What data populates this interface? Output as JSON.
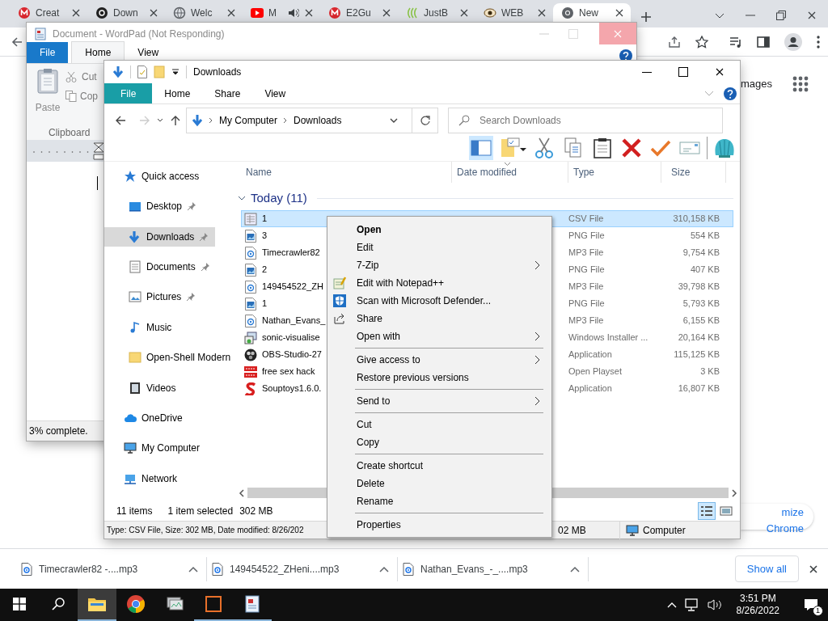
{
  "browser": {
    "tabs": [
      {
        "title": "Creat",
        "kind": "mega",
        "audio": false,
        "selected": false
      },
      {
        "title": "Down",
        "kind": "dark",
        "audio": false,
        "selected": false
      },
      {
        "title": "Welc",
        "kind": "globe",
        "audio": false,
        "selected": false
      },
      {
        "title": "M",
        "kind": "video",
        "audio": true,
        "selected": false
      },
      {
        "title": "E2Gu",
        "kind": "mega",
        "audio": false,
        "selected": false
      },
      {
        "title": "JustB",
        "kind": "wave",
        "audio": false,
        "selected": false
      },
      {
        "title": "WEB",
        "kind": "eye",
        "audio": false,
        "selected": false
      },
      {
        "title": "New",
        "kind": "chrome",
        "audio": false,
        "selected": true
      }
    ],
    "page_link": "mages",
    "customize_button": "mize Chrome"
  },
  "wordpad": {
    "title": "Document - WordPad (Not Responding)",
    "tabs": [
      {
        "label": "File",
        "kind": "file",
        "selected": false
      },
      {
        "label": "Home",
        "kind": "tab",
        "selected": true
      },
      {
        "label": "View",
        "kind": "tab",
        "selected": false
      }
    ],
    "paste": "Paste",
    "cut": "Cut",
    "copy": "Cop",
    "group": "Clipboard",
    "status": "3% complete."
  },
  "explorer": {
    "title": "Downloads",
    "tabs": [
      {
        "label": "File",
        "kind": "file",
        "selected": false
      },
      {
        "label": "Home",
        "kind": "tab",
        "selected": false
      },
      {
        "label": "Share",
        "kind": "tab",
        "selected": false
      },
      {
        "label": "View",
        "kind": "tab",
        "selected": false
      }
    ],
    "breadcrumb": [
      "My Computer",
      "Downloads"
    ],
    "search": {
      "placeholder": "Search Downloads"
    },
    "toolbar": [
      {
        "kind": "pane",
        "selected": true
      },
      {
        "kind": "folder",
        "selected": false
      },
      {
        "kind": "cut",
        "selected": false
      },
      {
        "kind": "copy",
        "selected": false
      },
      {
        "kind": "paste",
        "selected": false
      },
      {
        "kind": "delete",
        "selected": false
      },
      {
        "kind": "check",
        "selected": false
      },
      {
        "kind": "mail",
        "selected": false
      },
      {
        "kind": "shell",
        "selected": false
      }
    ],
    "nav": [
      {
        "label": "Quick access",
        "kind": "star",
        "children": [
          {
            "label": "Desktop",
            "kind": "desktop",
            "pinned": true,
            "selected": false
          },
          {
            "label": "Downloads",
            "kind": "download",
            "pinned": true,
            "selected": true
          },
          {
            "label": "Documents",
            "kind": "docs",
            "pinned": true,
            "selected": false
          },
          {
            "label": "Pictures",
            "kind": "pictures",
            "pinned": true,
            "selected": false
          },
          {
            "label": "Music",
            "kind": "music",
            "pinned": false,
            "selected": false
          },
          {
            "label": "Open-Shell Modern",
            "kind": "folder",
            "pinned": false,
            "selected": false
          },
          {
            "label": "Videos",
            "kind": "videos",
            "pinned": false,
            "selected": false
          }
        ]
      },
      {
        "label": "OneDrive",
        "kind": "cloud"
      },
      {
        "label": "My Computer",
        "kind": "computer"
      },
      {
        "label": "Network",
        "kind": "network"
      }
    ],
    "columns": [
      {
        "label": "Name",
        "sorted": false
      },
      {
        "label": "Date modified",
        "sorted": true
      },
      {
        "label": "Type",
        "sorted": false
      },
      {
        "label": "Size",
        "sorted": false
      }
    ],
    "group": {
      "label": "Today (11)",
      "expanded": true
    },
    "files": [
      {
        "name": "1",
        "kind": "csv",
        "type": "CSV File",
        "size": "310,158 KB",
        "selected": true
      },
      {
        "name": "3",
        "kind": "png",
        "type": "PNG File",
        "size": "554 KB",
        "selected": false
      },
      {
        "name": "Timecrawler82",
        "kind": "mp3",
        "type": "MP3 File",
        "size": "9,754 KB",
        "selected": false
      },
      {
        "name": "2",
        "kind": "png",
        "type": "PNG File",
        "size": "407 KB",
        "selected": false
      },
      {
        "name": "149454522_ZH",
        "kind": "mp3",
        "type": "MP3 File",
        "size": "39,798 KB",
        "selected": false
      },
      {
        "name": "1",
        "kind": "png",
        "type": "PNG File",
        "size": "5,793 KB",
        "selected": false
      },
      {
        "name": "Nathan_Evans_",
        "kind": "mp3",
        "type": "MP3 File",
        "size": "6,155 KB",
        "selected": false
      },
      {
        "name": "sonic-visualise",
        "kind": "msi",
        "type": "Windows Installer ...",
        "size": "20,164 KB",
        "selected": false
      },
      {
        "name": "OBS-Studio-27",
        "kind": "obs",
        "type": "Application",
        "size": "115,125 KB",
        "selected": false
      },
      {
        "name": "free sex hack",
        "kind": "playset",
        "type": "Open Playset",
        "size": "3 KB",
        "selected": false
      },
      {
        "name": "Souptoys1.6.0.",
        "kind": "soup",
        "type": "Application",
        "size": "16,807 KB",
        "selected": false
      }
    ],
    "status": {
      "count": "11 items",
      "selection": "1 item selected",
      "size": "302 MB"
    },
    "views": [
      {
        "kind": "details",
        "selected": true
      },
      {
        "kind": "thumbs",
        "selected": false
      }
    ],
    "details": {
      "text": "Type: CSV File, Size: 302 MB, Date modified: 8/26/202",
      "size": "02 MB",
      "location": "Computer"
    }
  },
  "context_menu": [
    {
      "kind": "item",
      "label": "Open",
      "default": true,
      "submenu": false
    },
    {
      "kind": "item",
      "label": "Edit",
      "default": false,
      "submenu": false
    },
    {
      "kind": "item",
      "label": "7-Zip",
      "default": false,
      "submenu": true
    },
    {
      "kind": "notepad",
      "label": "Edit with Notepad++",
      "default": false,
      "submenu": false
    },
    {
      "kind": "shield",
      "label": "Scan with Microsoft Defender...",
      "default": false,
      "submenu": false
    },
    {
      "kind": "share",
      "label": "Share",
      "default": false,
      "submenu": false
    },
    {
      "kind": "item",
      "label": "Open with",
      "default": false,
      "submenu": true
    },
    {
      "kind": "separator"
    },
    {
      "kind": "item",
      "label": "Give access to",
      "default": false,
      "submenu": true
    },
    {
      "kind": "item",
      "label": "Restore previous versions",
      "default": false,
      "submenu": false
    },
    {
      "kind": "separator"
    },
    {
      "kind": "item",
      "label": "Send to",
      "default": false,
      "submenu": true
    },
    {
      "kind": "separator"
    },
    {
      "kind": "item",
      "label": "Cut",
      "default": false,
      "submenu": false
    },
    {
      "kind": "item",
      "label": "Copy",
      "default": false,
      "submenu": false
    },
    {
      "kind": "separator"
    },
    {
      "kind": "item",
      "label": "Create shortcut",
      "default": false,
      "submenu": false
    },
    {
      "kind": "item",
      "label": "Delete",
      "default": false,
      "submenu": false
    },
    {
      "kind": "item",
      "label": "Rename",
      "default": false,
      "submenu": false
    },
    {
      "kind": "separator"
    },
    {
      "kind": "item",
      "label": "Properties",
      "default": false,
      "submenu": false
    }
  ],
  "downloads": {
    "items": [
      {
        "name": "Timecrawler82 -....mp3"
      },
      {
        "name": "149454522_ZHeni....mp3"
      },
      {
        "name": "Nathan_Evans_-_....mp3"
      }
    ],
    "show_all": "Show all"
  },
  "taskbar": {
    "apps": [
      {
        "kind": "folder",
        "active": true,
        "running": true
      },
      {
        "kind": "chrome",
        "active": false,
        "running": false
      },
      {
        "kind": "monitor",
        "active": false,
        "running": false
      },
      {
        "kind": "square",
        "active": false,
        "running": true
      },
      {
        "kind": "doc",
        "active": false,
        "running": true
      }
    ],
    "time": "3:51 PM",
    "date": "8/26/2022",
    "notifications": "1"
  }
}
